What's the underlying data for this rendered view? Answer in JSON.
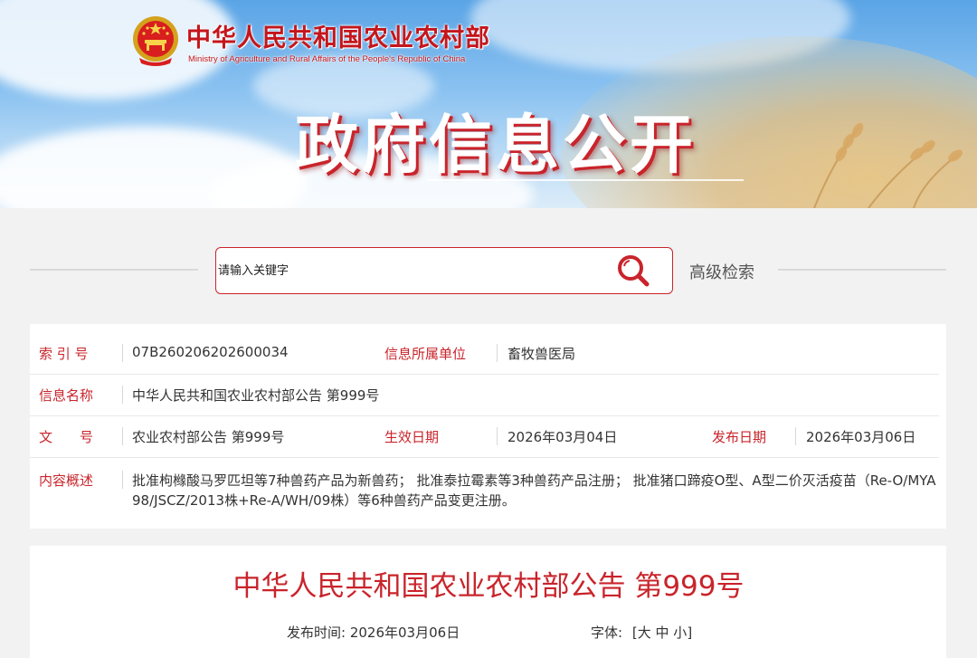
{
  "header": {
    "ministry_cn": "中华人民共和国农业农村部",
    "ministry_en": "Ministry of Agriculture and Rural Affairs of the People's Republic of China",
    "section_title": "政府信息公开",
    "emblem_icon": "national-emblem-icon"
  },
  "search": {
    "placeholder": "请输入关键字",
    "icon": "search-icon",
    "advanced_label": "高级检索"
  },
  "info": {
    "index_label": "索 引 号",
    "index_value": "07B260206202600034",
    "unit_label": "信息所属单位",
    "unit_value": "畜牧兽医局",
    "name_label": "信息名称",
    "name_value": "中华人民共和国农业农村部公告 第999号",
    "doc_label": "文　　号",
    "doc_value": "农业农村部公告 第999号",
    "effective_label": "生效日期",
    "effective_value": "2026年03月04日",
    "publish_label": "发布日期",
    "publish_value": "2026年03月06日",
    "summary_label": "内容概述",
    "summary_value": "批准枸橼酸马罗匹坦等7种兽药产品为新兽药； 批准泰拉霉素等3种兽药产品注册； 批准猪口蹄疫O型、A型二价灭活疫苗（Re-O/MYA98/JSCZ/2013株+Re-A/WH/09株）等6种兽药产品变更注册。"
  },
  "article": {
    "title": "中华人民共和国农业农村部公告 第999号",
    "publish_time_label": "发布时间:",
    "publish_time_value": "2026年03月06日",
    "font_size_label": "字体:",
    "font_open": "[",
    "font_large": "大",
    "font_medium": "中",
    "font_small": "小",
    "font_close": "]"
  },
  "colors": {
    "accent_red": "#c9242b",
    "sky_blue": "#5aa4e6",
    "wheat": "#e2ba78"
  }
}
